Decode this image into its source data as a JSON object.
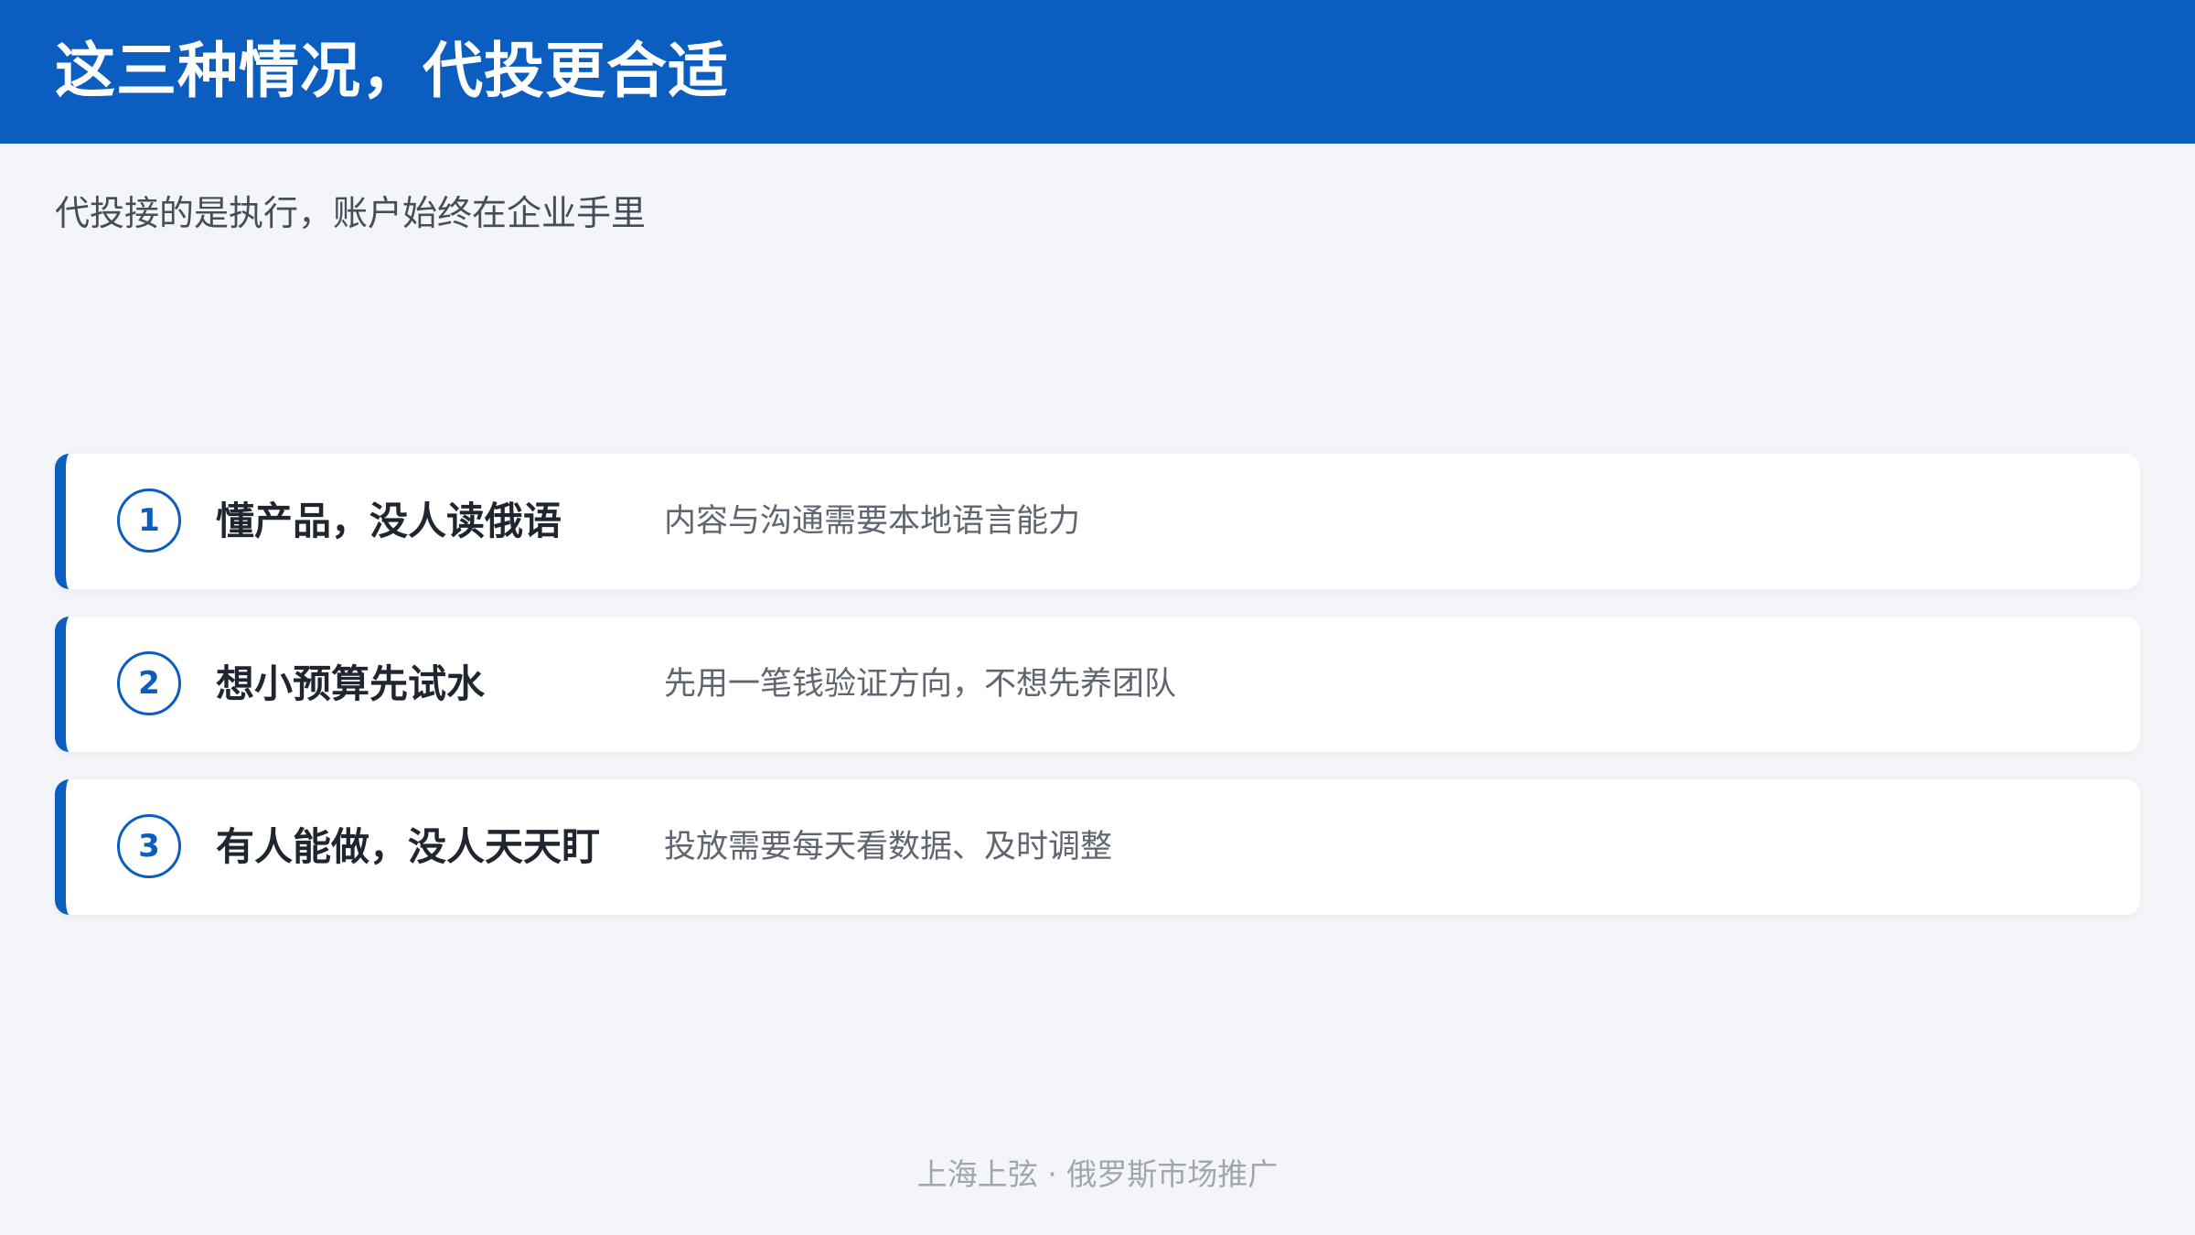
{
  "header": {
    "title": "这三种情况，代投更合适"
  },
  "intro": {
    "subtitle": "代投接的是执行，账户始终在企业手里"
  },
  "cases": [
    {
      "number": "1",
      "title": "懂产品，没人读俄语",
      "description": "内容与沟通需要本地语言能力"
    },
    {
      "number": "2",
      "title": "想小预算先试水",
      "description": "先用一笔钱验证方向，不想先养团队"
    },
    {
      "number": "3",
      "title": "有人能做，没人天天盯",
      "description": "投放需要每天看数据、及时调整"
    }
  ],
  "footer": {
    "text": "上海上弦 · 俄罗斯市场推广"
  },
  "colors": {
    "brand_blue": "#0b5ec0",
    "page_background": "#f3f5f9",
    "card_background": "#ffffff",
    "title_text": "#ffffff",
    "body_text": "#1f2630",
    "muted_text": "#5f6670",
    "footer_text": "#a0a6ad"
  }
}
